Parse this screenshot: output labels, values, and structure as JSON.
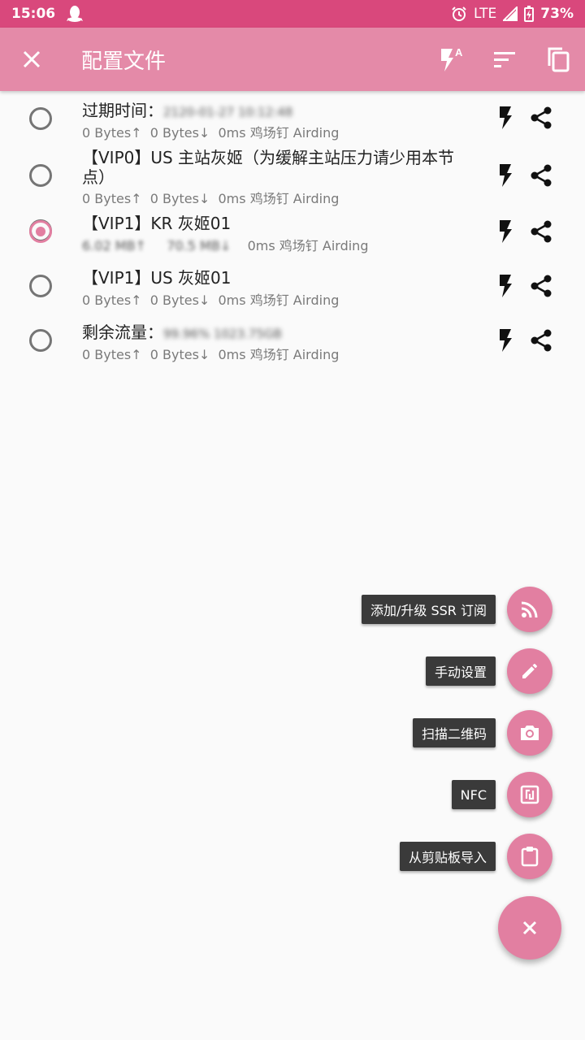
{
  "status_bar": {
    "time": "15:06",
    "network": "LTE",
    "battery": "73%",
    "icons": [
      "qq-icon",
      "alarm-icon",
      "signal-icon",
      "battery-icon"
    ]
  },
  "app_bar": {
    "title": "配置文件",
    "actions": [
      "test-all-icon",
      "sort-icon",
      "copy-icon"
    ]
  },
  "profiles": [
    {
      "name": "过期时间：",
      "name_hidden": "2120-01-27 10:12:48",
      "upload": "0 Bytes↑",
      "download": "0 Bytes↓",
      "latency": "0ms",
      "group": "鸡场钉 Airding",
      "selected": false
    },
    {
      "name": "【VIP0】US 主站灰姬（为缓解主站压力请少用本节点）",
      "upload": "0 Bytes↑",
      "download": "0 Bytes↓",
      "latency": "0ms",
      "group": "鸡场钉 Airding",
      "selected": false
    },
    {
      "name": "【VIP1】KR 灰姬01",
      "upload": "6.02 MB↑",
      "download": "70.5 MB↓",
      "latency": "0ms",
      "group": "鸡场钉 Airding",
      "selected": true
    },
    {
      "name": "【VIP1】US 灰姬01",
      "upload": "0 Bytes↑",
      "download": "0 Bytes↓",
      "latency": "0ms",
      "group": "鸡场钉 Airding",
      "selected": false
    },
    {
      "name": "剩余流量：",
      "name_hidden": "99.96% 1023.75GB",
      "upload": "0 Bytes↑",
      "download": "0 Bytes↓",
      "latency": "0ms",
      "group": "鸡场钉 Airding",
      "selected": false
    }
  ],
  "fab_menu": {
    "items": [
      {
        "label": "添加/升级 SSR 订阅",
        "icon": "rss-icon"
      },
      {
        "label": "手动设置",
        "icon": "pencil-icon"
      },
      {
        "label": "扫描二维码",
        "icon": "camera-icon"
      },
      {
        "label": "NFC",
        "icon": "nfc-icon"
      },
      {
        "label": "从剪贴板导入",
        "icon": "clipboard-icon"
      }
    ],
    "main_icon": "close-icon"
  },
  "colors": {
    "status_bar": "#d9487c",
    "app_bar": "#e48aa8",
    "accent": "#e27fa1",
    "background": "#fafafa"
  }
}
